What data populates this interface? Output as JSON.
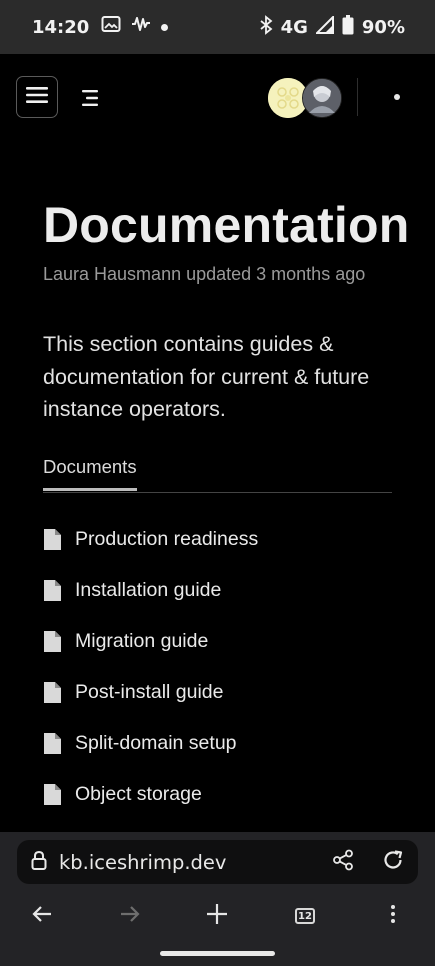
{
  "status": {
    "time": "14:20",
    "network": "4G",
    "battery": "90%",
    "icons": [
      "image-icon",
      "waveform-icon",
      "notification-dot-icon",
      "bluetooth-icon",
      "signal-icon",
      "battery-icon"
    ]
  },
  "header": {
    "menu_icon": "hamburger-icon",
    "toc_icon": "table-of-contents-icon",
    "more_icon": "more-horizontal-icon"
  },
  "page": {
    "title": "Documentation",
    "meta": "Laura Hausmann updated 3 months ago",
    "description": "This section contains guides & documentation for current & future instance operators."
  },
  "tabs": [
    {
      "label": "Documents",
      "active": true
    }
  ],
  "documents": [
    {
      "label": "Production readiness"
    },
    {
      "label": "Installation guide"
    },
    {
      "label": "Migration guide"
    },
    {
      "label": "Post-install guide"
    },
    {
      "label": "Split-domain setup"
    },
    {
      "label": "Object storage"
    }
  ],
  "browser": {
    "url": "kb.iceshrimp.dev",
    "tab_count": "12",
    "icons": [
      "lock-icon",
      "share-icon",
      "reload-icon",
      "back-icon",
      "forward-icon",
      "new-tab-icon",
      "tabs-icon",
      "menu-icon"
    ]
  },
  "colors": {
    "background": "#000000",
    "status_bar": "#2b2b2b",
    "chrome": "#232326",
    "muted_text": "#9a9a9a"
  }
}
